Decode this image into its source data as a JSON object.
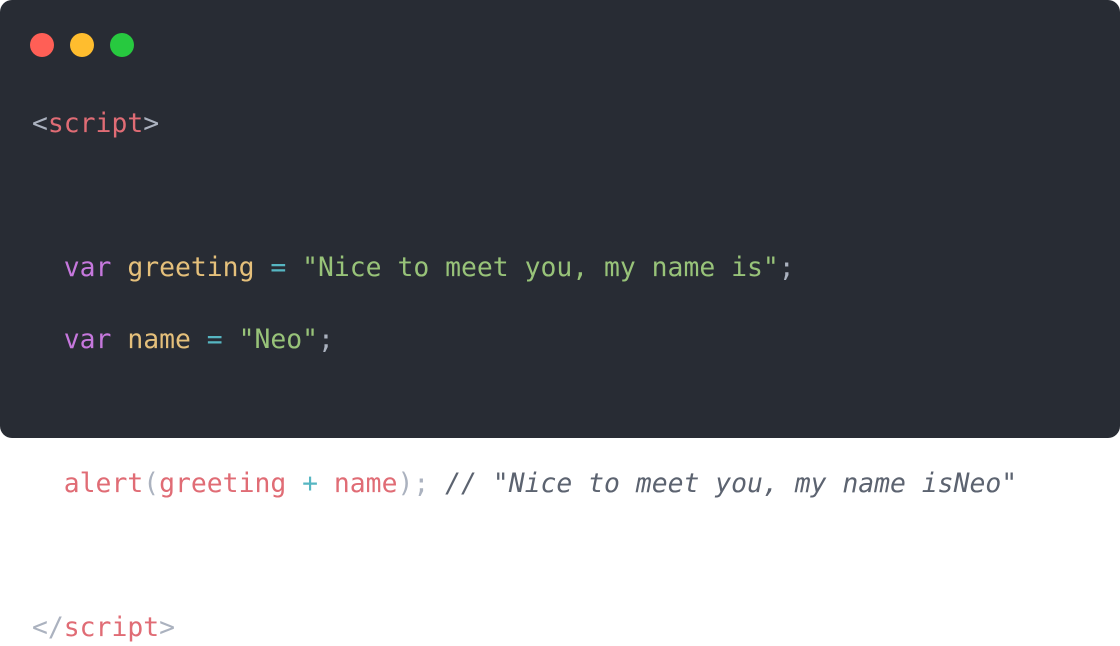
{
  "window_controls": {
    "close_color": "#ff5f56",
    "minimize_color": "#ffbd2e",
    "maximize_color": "#27c93f"
  },
  "colors": {
    "background": "#282c34",
    "tag": "#e06c75",
    "bracket": "#abb2bf",
    "keyword": "#c678dd",
    "variable": "#e5c07b",
    "operator": "#56b6c2",
    "string": "#98c379",
    "function": "#e06c75",
    "punctuation": "#abb2bf",
    "comment": "#5c6370"
  },
  "code": {
    "line1": {
      "lt": "<",
      "tag": "script",
      "gt": ">"
    },
    "line3": {
      "kw": "var",
      "name": "greeting",
      "op": "=",
      "str": "\"Nice to meet you, my name is\"",
      "semi": ";"
    },
    "line4": {
      "kw": "var",
      "name": "name",
      "op": "=",
      "str": "\"Neo\"",
      "semi": ";"
    },
    "line6": {
      "fn": "alert",
      "open": "(",
      "arg1": "greeting",
      "op": "+",
      "arg2": "name",
      "close": ");",
      "comment": "// \"Nice to meet you, my name isNeo\""
    },
    "line8": {
      "lt": "</",
      "tag": "script",
      "gt": ">"
    }
  }
}
